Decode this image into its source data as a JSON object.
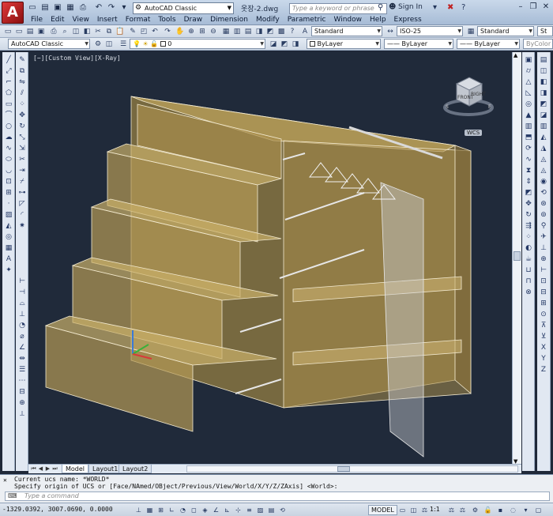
{
  "titlebar": {
    "workspace": "AutoCAD Classic",
    "file_title": "옷장-2.dwg",
    "search_placeholder": "Type a keyword or phrase",
    "signin": "Sign In"
  },
  "menu": [
    "File",
    "Edit",
    "View",
    "Insert",
    "Format",
    "Tools",
    "Draw",
    "Dimension",
    "Modify",
    "Parametric",
    "Window",
    "Help",
    "Express"
  ],
  "styles_toolbar": {
    "text_style": "Standard",
    "dim_style": "ISO-25",
    "table_style": "Standard",
    "multileader_style": "St"
  },
  "layers_toolbar": {
    "workspace": "AutoCAD Classic",
    "layer": "0",
    "color": "ByLayer",
    "linetype": "ByLayer",
    "lineweight": "ByLayer",
    "plotstyle": "ByColor"
  },
  "viewport": {
    "label": "[−][Custom View][X-Ray]",
    "wcs": "WCS"
  },
  "viewcube": {
    "front": "FRONT",
    "right": "RIGHT",
    "compass": [
      "N",
      "E",
      "S",
      "W"
    ]
  },
  "tabs": [
    "Model",
    "Layout1",
    "Layout2"
  ],
  "command": {
    "history": [
      "Current ucs name:  *WORLD*",
      "Specify origin of UCS or [Face/NAmed/OBject/Previous/View/World/X/Y/Z/ZAxis] <World>:"
    ],
    "prompt": "Type a command"
  },
  "status": {
    "coords": "-1329.0392, 3007.0690, 0.0000",
    "model": "MODEL",
    "scale": "1:1"
  }
}
